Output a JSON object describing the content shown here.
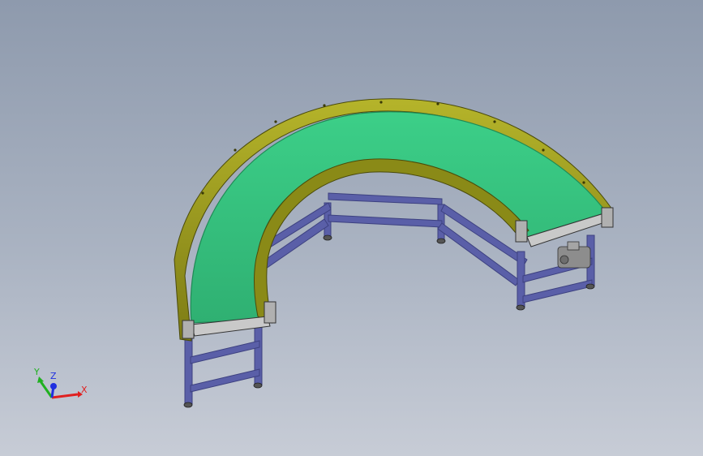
{
  "viewport": {
    "background_top": "#8e9aad",
    "background_bottom": "#c7ccd6"
  },
  "model": {
    "belt_color": "#35c27e",
    "belt_edge_color": "#1f8a55",
    "side_guard_color": "#9b9a1f",
    "frame_color": "#5a5fa8",
    "frame_dark": "#3d4180",
    "motor_color": "#8d8d8d"
  },
  "triad": {
    "x_label": "X",
    "y_label": "Y",
    "z_label": "Z",
    "x_color": "#e02020",
    "y_color": "#20b020",
    "z_color": "#2030e0"
  }
}
